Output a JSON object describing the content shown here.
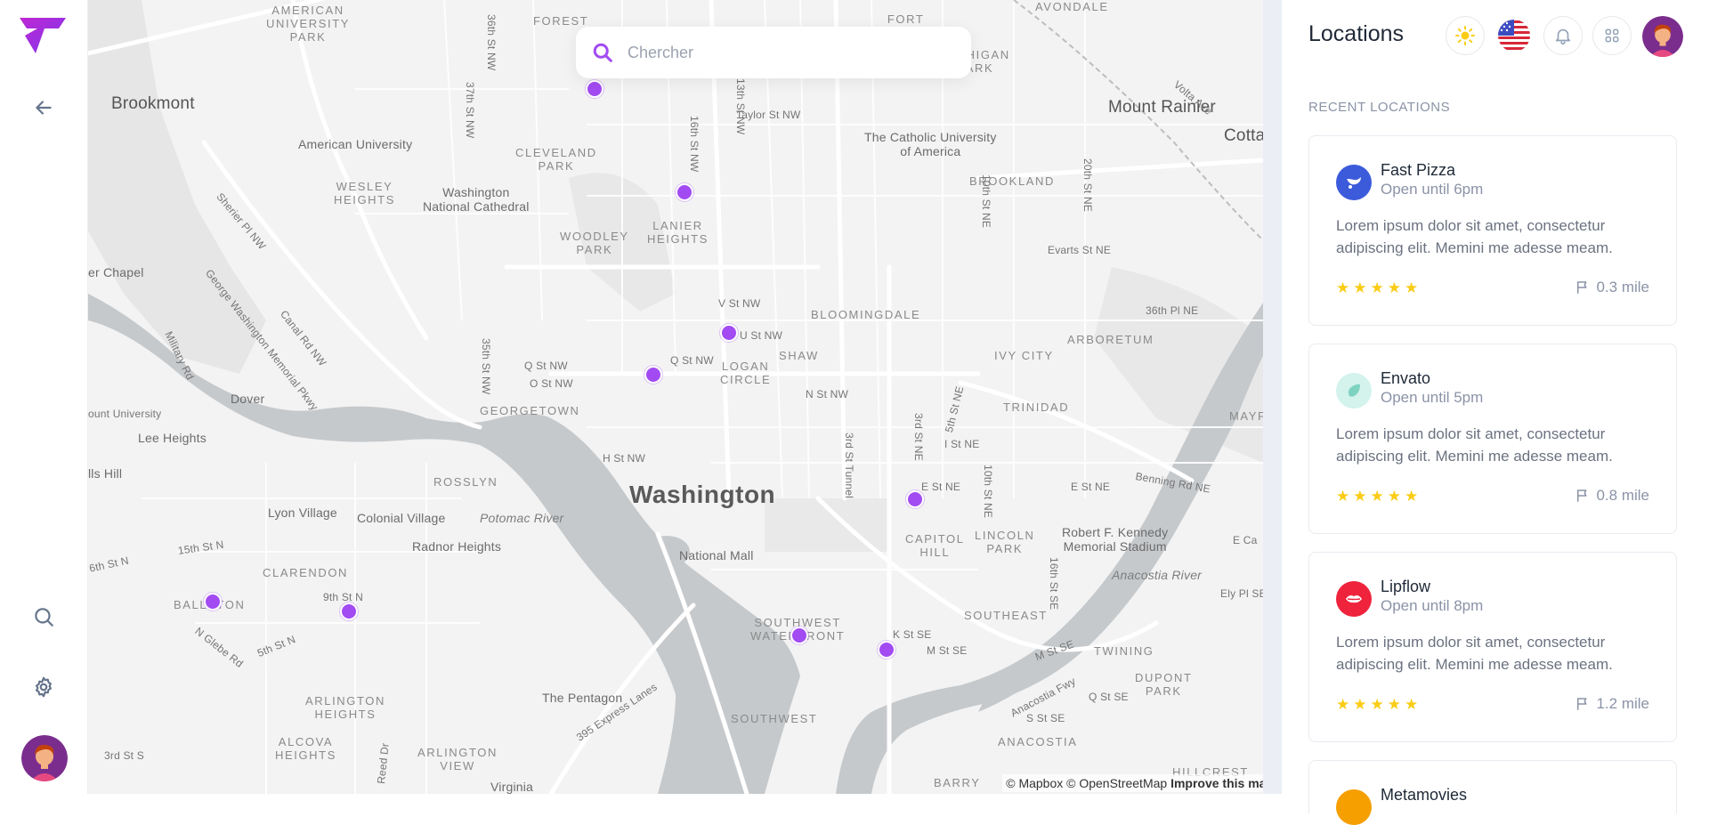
{
  "map": {
    "search_placeholder": "Chercher",
    "labels": {
      "brookmont": "Brookmont",
      "american_university_park": "AMERICAN\nUNIVERSITY\nPARK",
      "forest": "FOREST",
      "fort_totten": "FORT\nTOTTEN",
      "michigan_park": "MICHIGAN\nPARK",
      "avondale": "AVONDALE",
      "mount_rainier": "Mount Rainier",
      "cotta": "Cotta",
      "american_university": "American University",
      "cleveland_park": "CLEVELAND\nPARK",
      "taylor_st": "Taylor St NW",
      "catholic_university": "The Catholic University\nof America",
      "brookland": "BROOKLAND",
      "wesley_heights": "WESLEY\nHEIGHTS",
      "washington_cathedral": "Washington\nNational Cathedral",
      "woodley_park": "WOODLEY\nPARK",
      "lanier_heights": "LANIER\nHEIGHTS",
      "evarts_st": "Evarts St NE",
      "sherier_pl": "Sherier Pl NW",
      "chapel": "er Chapel",
      "v_st": "V St NW",
      "u_st": "U St NW",
      "bloomingdale": "BLOOMINGDALE",
      "36th_pl": "36th Pl NE",
      "arboretum": "ARBORETUM",
      "shaw": "SHAW",
      "ivy_city": "IVY CITY",
      "q_st_nw_left": "Q St NW",
      "o_st_nw": "O St NW",
      "q_st_nw": "Q St NW",
      "logan_circle": "LOGAN\nCIRCLE",
      "n_st_nw": "N St NW",
      "trinidad": "TRINIDAD",
      "mayf": "MAYF",
      "military_rd": "Military Rd",
      "dover": "Dover",
      "georgetown": "GEORGETOWN",
      "university": "ount University",
      "lee_heights": "Lee Heights",
      "h_st_nw": "H St NW",
      "i_st_ne": "I St NE",
      "hills": "lls Hill",
      "rosslyn": "ROSSLYN",
      "washington": "Washington",
      "e_st_ne": "E St NE",
      "e_st_ne2": "E St NE",
      "benning_rd": "Benning Rd NE",
      "lyon_village": "Lyon Village",
      "colonial_village": "Colonial Village",
      "potomac_river": "Potomac River",
      "radnor_heights": "Radnor Heights",
      "national_mall": "National Mall",
      "capitol_hill": "CAPITOL\nHILL",
      "lincoln_park": "LINCOLN\nPARK",
      "rfk_stadium": "Robert F. Kennedy\nMemorial Stadium",
      "e_ca": "E Ca",
      "15th_st_n": "15th St N",
      "6th_st_n": "6th St N",
      "clarendon": "CLARENDON",
      "anacostia_river": "Anacostia River",
      "ely_pl": "Ely Pl SE",
      "ballston": "BALLSTON",
      "9th_st_n": "9th St N",
      "southwest_waterfront": "SOUTHWEST\nWATERFRONT",
      "k_st_se": "K St SE",
      "m_st_se": "M St SE",
      "southeast": "SOUTHEAST",
      "m_st_se2": "M St SE",
      "twining": "TWINING",
      "n_glebe": "N Glebe Rd",
      "5th_st_n": "5th St N",
      "pentagon": "The Pentagon",
      "arlington_heights": "ARLINGTON\nHEIGHTS",
      "southwest": "SOUTHWEST",
      "anacostia_fwy": "Anacostia Fwy",
      "q_st_se": "Q St SE",
      "s_st_se": "S St SE",
      "dupont_park": "DUPONT\nPARK",
      "395": "395 Express Lanes",
      "alcova_heights": "ALCOVA\nHEIGHTS",
      "arlington_view": "ARLINGTON\nVIEW",
      "anacostia": "ANACOSTIA",
      "3rd_st_s": "3rd St S",
      "reed_dr": "Reed Dr",
      "virginia": "Virginia",
      "barry": "BARRY",
      "hillcrest": "HILLCREST",
      "36th_st": "36th St NW",
      "37th_st": "37th St NW",
      "16th_st": "16th St NW",
      "13th_st": "13th St NW",
      "10th_st_ne": "10th St NE",
      "20th_st_ne": "20th St NE",
      "35th_st": "35th St NW",
      "3rd_st_tunnel": "3rd St Tunnel",
      "3rd_st_ne": "3rd St NE",
      "5th_st_ne": "5th St NE",
      "10th_st_ne2": "10th St NE",
      "16th_st_se": "16th St SE",
      "gw_parkway": "George Washington Memorial Pkwy",
      "canal_rd": "Canal Rd NW",
      "volta_ave": "Volta Ave"
    },
    "attribution": {
      "mapbox": "© Mapbox",
      "osm": "© OpenStreetMap",
      "improve": "Improve this map"
    },
    "pin_color": "#a24bf2"
  },
  "panel": {
    "title": "Locations",
    "section_label": "RECENT LOCATIONS",
    "locations": [
      {
        "name": "Fast Pizza",
        "hours": "Open until 6pm",
        "description": "Lorem ipsum dolor sit amet, consectetur adipiscing elit. Memini me adesse meam.",
        "rating": 5,
        "distance": "0.3 mile",
        "logo_color": "#3b5bdb",
        "logo_icon": "fast-pizza-logo-icon"
      },
      {
        "name": "Envato",
        "hours": "Open until 5pm",
        "description": "Lorem ipsum dolor sit amet, consectetur adipiscing elit. Memini me adesse meam.",
        "rating": 5,
        "distance": "0.8 mile",
        "logo_color": "#7dd3c0",
        "logo_icon": "envato-logo-icon"
      },
      {
        "name": "Lipflow",
        "hours": "Open until 8pm",
        "description": "Lorem ipsum dolor sit amet, consectetur adipiscing elit. Memini me adesse meam.",
        "rating": 5,
        "distance": "1.2 mile",
        "logo_color": "#ef233c",
        "logo_icon": "lipflow-logo-icon"
      },
      {
        "name": "Metamovies",
        "logo_color": "#f59f00"
      }
    ]
  },
  "colors": {
    "accent": "#a24bf2",
    "star": "#facc15",
    "muted_text": "#8b93a7"
  }
}
